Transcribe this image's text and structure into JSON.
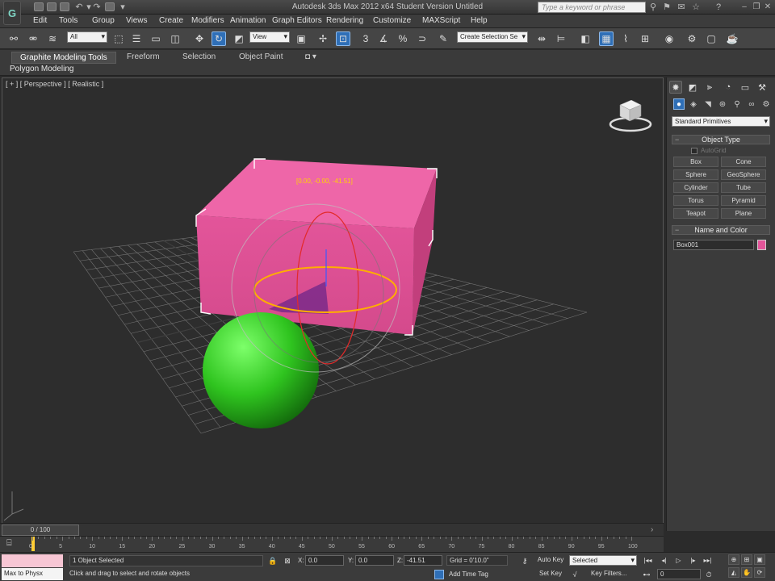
{
  "window": {
    "title": "Autodesk 3ds Max  2012 x64     Student Version    Untitled",
    "logo_letter": "G",
    "search_placeholder": "Type a keyword or phrase"
  },
  "menu": {
    "items": [
      "Edit",
      "Tools",
      "Group",
      "Views",
      "Create",
      "Modifiers",
      "Animation",
      "Graph Editors",
      "Rendering",
      "Customize",
      "MAXScript",
      "Help"
    ]
  },
  "toolbar": {
    "selection_filter": "All",
    "ref_coord": "View",
    "named_selection": "Create Selection Se"
  },
  "ribbon": {
    "tabs": [
      "Graphite Modeling Tools",
      "Freeform",
      "Selection",
      "Object Paint"
    ],
    "sub_label": "Polygon Modeling"
  },
  "viewport": {
    "label": "[ + ] [ Perspective ] [ Realistic ]",
    "coord_readout": "[0.00, -0.00, -41.51]",
    "box_color": "#e3559a",
    "sphere_color": "#33cc22"
  },
  "command_panel": {
    "category": "Standard Primitives",
    "object_type_title": "Object Type",
    "autogrid_label": "AutoGrid",
    "primitives": [
      "Box",
      "Cone",
      "Sphere",
      "GeoSphere",
      "Cylinder",
      "Tube",
      "Torus",
      "Pyramid",
      "Teapot",
      "Plane"
    ],
    "name_color_title": "Name and Color",
    "object_name": "Box001",
    "object_color": "#e3559a"
  },
  "timeline": {
    "frame_display": "0 / 100",
    "ticks": [
      "0",
      "5",
      "10",
      "15",
      "20",
      "25",
      "30",
      "35",
      "40",
      "45",
      "50",
      "55",
      "60",
      "65",
      "70",
      "75",
      "80",
      "85",
      "90",
      "95",
      "100"
    ]
  },
  "status": {
    "maxscript_text": "Max to Physx",
    "selection_count": "1 Object Selected",
    "prompt": "Click and drag to select and rotate objects",
    "x_label": "X:",
    "x_value": "0.0",
    "y_label": "Y:",
    "y_value": "0.0",
    "z_label": "Z:",
    "z_value": "-41.51",
    "grid": "Grid = 0'10.0\"",
    "add_time_tag": "Add Time Tag",
    "auto_key": "Auto Key",
    "set_key": "Set Key",
    "key_mode": "Selected",
    "key_filters": "Key Filters...",
    "current_frame": "0"
  }
}
